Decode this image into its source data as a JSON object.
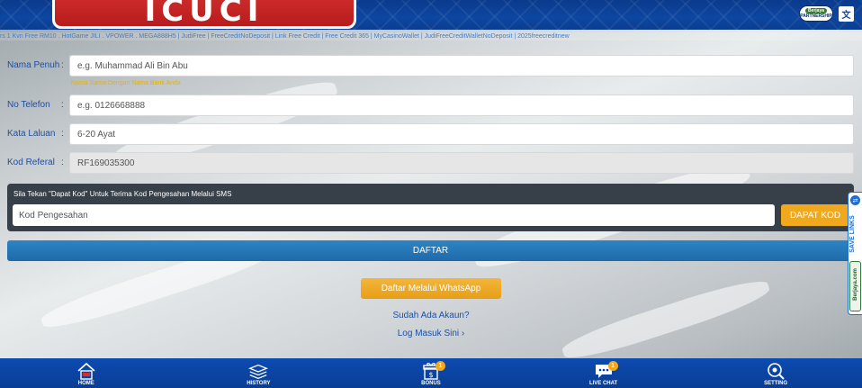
{
  "header": {
    "logo_text": "ICUCI",
    "partner_badge_top": "Berjaya",
    "partner_badge_bottom": "PARTNERSHIP",
    "language_icon": "translate-icon",
    "ticker": "rs 1 Kvn Free RM10 . HotGame JILI . VPOWER . MEGA888H5 | JudiFree | FreeCreditNoDeposit | Link Free Credit | Free Credit 365 | MyCasinoWallet | JudiFreeCreditWalletNoDeposit | 2025freecreditnew"
  },
  "form": {
    "name": {
      "label": "Nama Penuh",
      "colon": ":",
      "placeholder": "e.g. Muhammad Ali Bin Abu",
      "hint": "Nama Sama Dengan Nama Bank Anda"
    },
    "phone": {
      "label": "No Telefon",
      "colon": ":",
      "placeholder": "e.g. 0126668888"
    },
    "password": {
      "label": "Kata Laluan",
      "colon": ":",
      "placeholder": "6-20 Ayat"
    },
    "referral": {
      "label": "Kod Referal",
      "colon": ":",
      "value": "RF169035300"
    },
    "sms": {
      "note": "Sila Tekan \"Dapat Kod\" Untuk Terima Kod Pengesahan Melalui SMS",
      "placeholder": "Kod Pengesahan",
      "get_code_label": "DAPAT KOD"
    },
    "submit_label": "DAFTAR",
    "whatsapp_label": "Daftar Melalui WhatsApp",
    "has_account": "Sudah Ada Akaun?",
    "login_link": "Log Masuk Sini ›"
  },
  "side_tab": {
    "save_label": "SAVE LINKS",
    "brand": "Berjaya.com"
  },
  "bottom_nav": {
    "items": [
      {
        "label": "HOME",
        "icon": "home-icon"
      },
      {
        "label": "HISTORY",
        "icon": "history-icon"
      },
      {
        "label": "BONUS",
        "icon": "gift-icon",
        "badge": "1"
      },
      {
        "label": "LIVE CHAT",
        "icon": "chat-icon",
        "badge": "1"
      },
      {
        "label": "SETTING",
        "icon": "setting-icon"
      }
    ]
  },
  "colors": {
    "brand_blue": "#0d47a1",
    "accent_orange": "#f0a81f",
    "label_blue": "#1e4fa0",
    "panel_dark": "#374048"
  }
}
